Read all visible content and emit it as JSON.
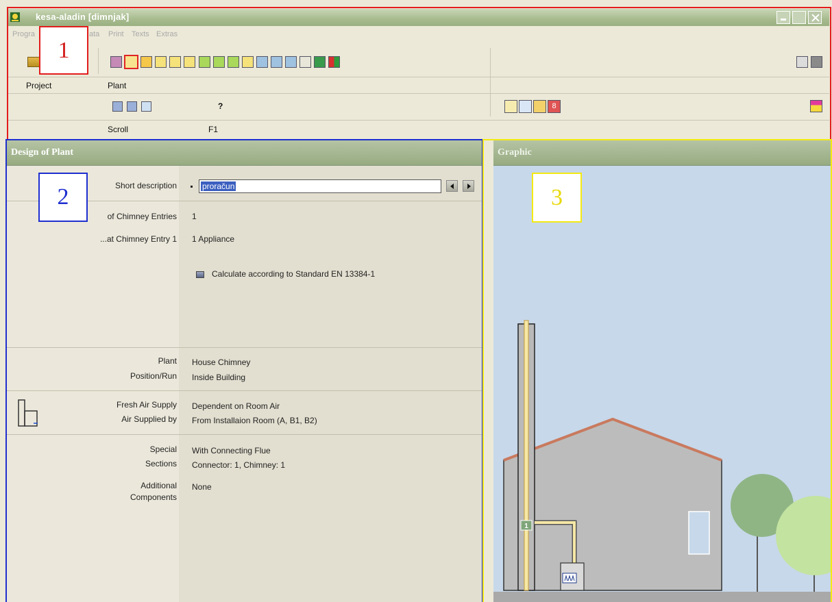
{
  "window": {
    "title": "kesa-aladin [dimnjak]"
  },
  "menu": {
    "items": [
      "Progra",
      "ata",
      "Print",
      "Texts",
      "Extras"
    ]
  },
  "toolbar": {
    "row1_labels": {
      "project": "Project",
      "plant": "Plant"
    },
    "row2_labels": {
      "scroll": "Scroll",
      "f1": "F1"
    },
    "help_glyph": "?",
    "alert_digit": "8"
  },
  "annotations": [
    "1",
    "2",
    "3"
  ],
  "design_panel": {
    "title": "Design of Plant",
    "short_description": {
      "label": "Short description",
      "value": "proračun"
    },
    "chimney_entries": {
      "label": "of Chimney Entries",
      "value": "1"
    },
    "chimney_entry1": {
      "label": "...at Chimney Entry 1",
      "value": "1 Appliance"
    },
    "standard": {
      "label": "Calculate according to Standard EN 13384-1",
      "checked": true
    },
    "plant": {
      "label": "Plant",
      "value": "House Chimney"
    },
    "position": {
      "label": "Position/Run",
      "value": "Inside Building"
    },
    "fresh_air": {
      "label": "Fresh Air Supply",
      "value": "Dependent on Room Air"
    },
    "air_supplied": {
      "label": "Air Supplied by",
      "value": "From Installaion Room (A, B1, B2)"
    },
    "special": {
      "label": "Special",
      "value": "With Connecting Flue"
    },
    "sections": {
      "label": "Sections",
      "value": "Connector: 1, Chimney: 1"
    },
    "additional": {
      "label1": "Additional",
      "label2": "Components",
      "value": "None"
    }
  },
  "graphic_panel": {
    "title": "Graphic",
    "entry_marker": "1"
  },
  "colors": {
    "header_green": "#9fb287",
    "sky": "#c7d8ea",
    "house": "#bdbdbd",
    "roof": "#c97a5f",
    "annot_red": "#e31c1c",
    "annot_blue": "#1e2ecf",
    "annot_yellow": "#f3ea12"
  }
}
